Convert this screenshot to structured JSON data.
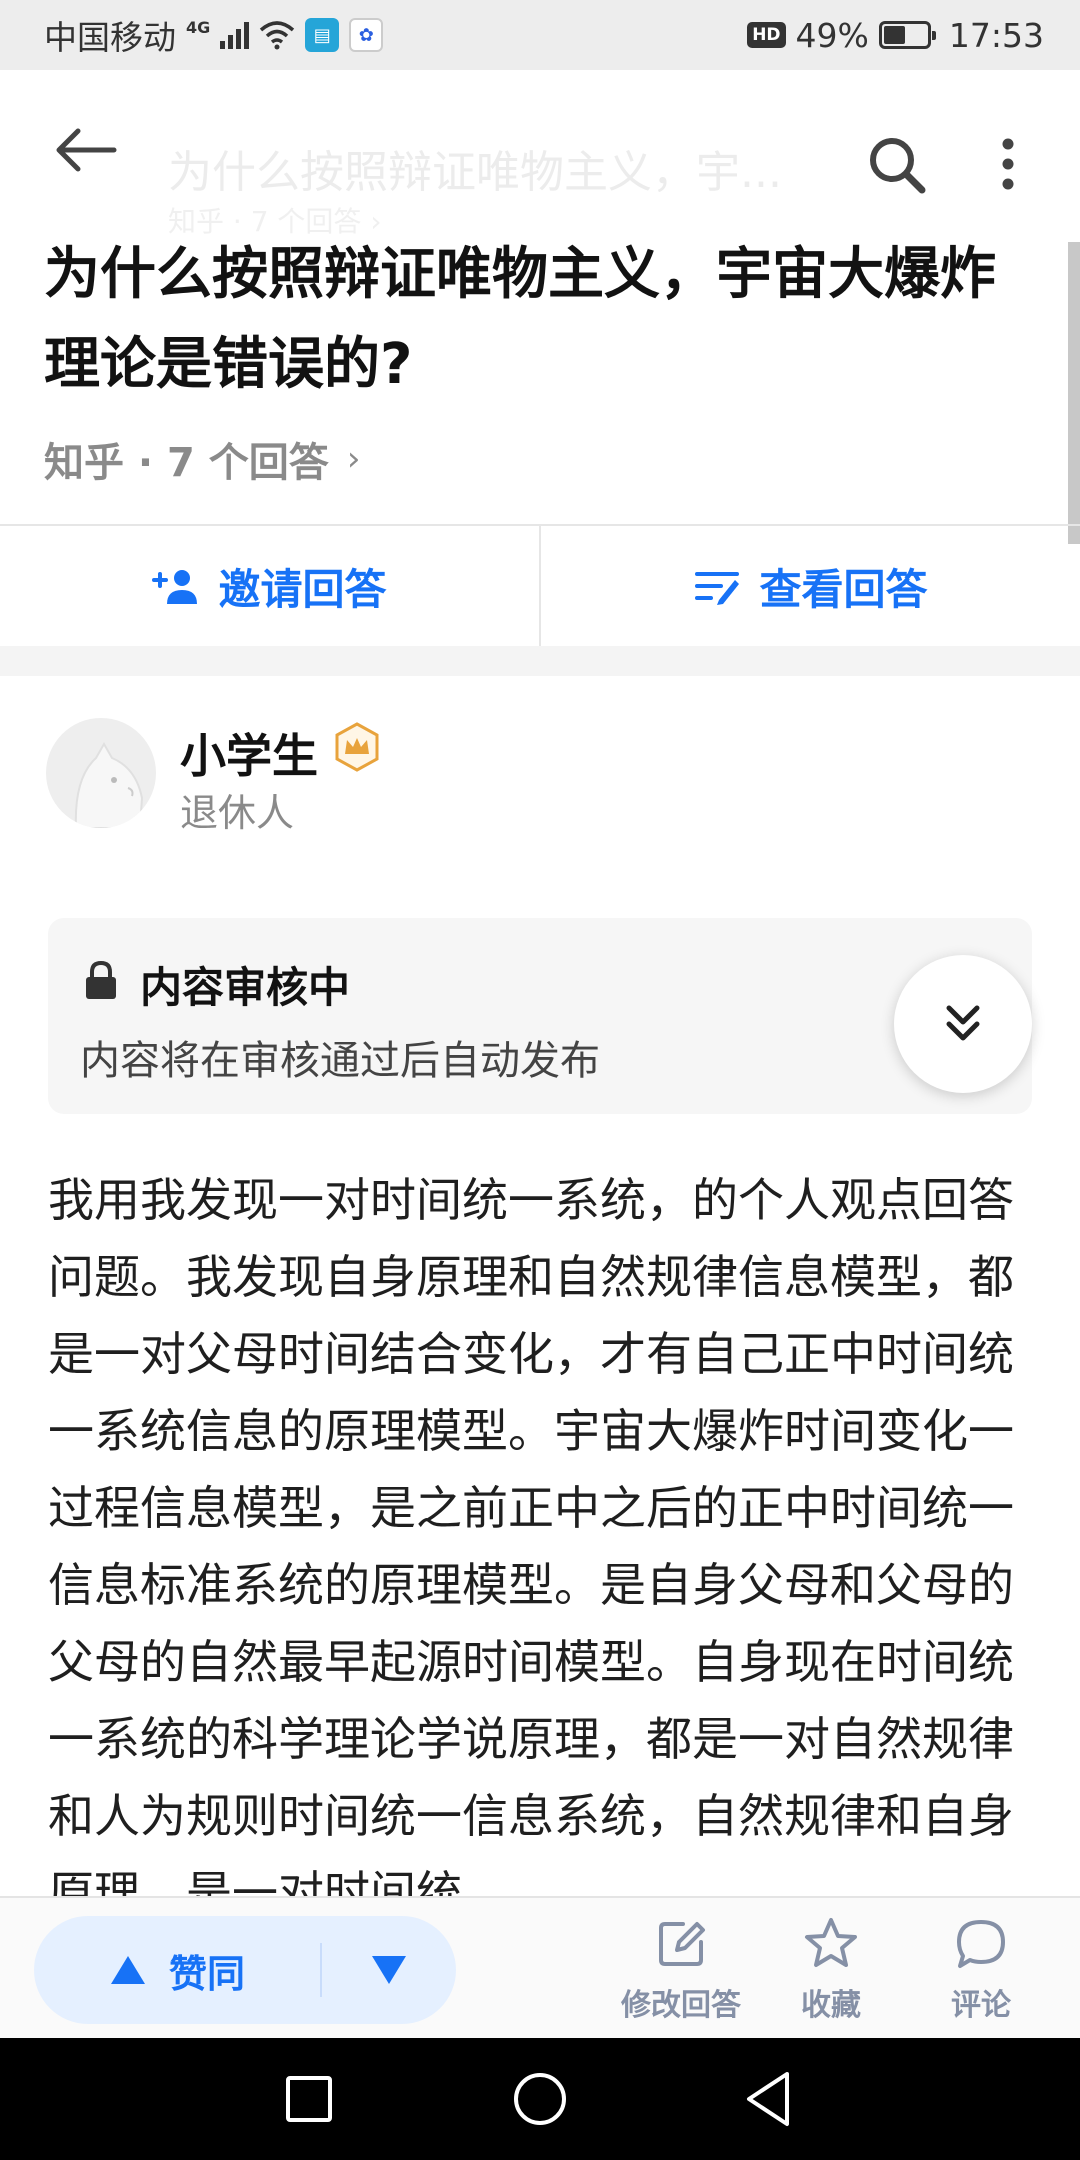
{
  "status_bar": {
    "carrier": "中国移动",
    "network": "4G",
    "hd": "HD",
    "battery": "49%",
    "battery_level": 0.49,
    "time": "17:53"
  },
  "top_bar": {
    "ghost_title": "为什么按照辩证唯物主义，宇...",
    "ghost_sub": "知乎 · 7 个回答 ›"
  },
  "question": {
    "title": "为什么按照辩证唯物主义，宇宙大爆炸理论是错误的?",
    "source": "知乎 · 7 个回答",
    "chevron": "›"
  },
  "actions": {
    "invite": "邀请回答",
    "view": "查看回答"
  },
  "author": {
    "name": "小学生",
    "desc": "退休人"
  },
  "review": {
    "title": "内容审核中",
    "desc": "内容将在审核通过后自动发布"
  },
  "answer": {
    "text": "我用我发现一对时间统一系统，的个人观点回答问题。我发现自身原理和自然规律信息模型，都是一对父母时间结合变化，才有自己正中时间统一系统信息的原理模型。宇宙大爆炸时间变化一过程信息模型，是之前正中之后的正中时间统一信息标准系统的原理模型。是自身父母和父母的父母的自然最早起源时间模型。自身现在时间统一系统的科学理论学说原理，都是一对自然规律和人为规则时间统一信息系统，自然规律和自身原理，是一对时间统"
  },
  "bottom_bar": {
    "upvote": "赞同",
    "edit": "修改回答",
    "favorite": "收藏",
    "comment": "评论"
  },
  "colors": {
    "accent": "#1772f6",
    "muted": "#8590a6",
    "badge": "#e8a33c"
  },
  "icons": [
    "back-arrow-icon",
    "search-icon",
    "more-vertical-icon",
    "invite-person-icon",
    "view-answers-icon",
    "crown-badge-icon",
    "lock-icon",
    "double-chevron-down-icon",
    "upvote-triangle-icon",
    "downvote-triangle-icon",
    "edit-icon",
    "star-icon",
    "comment-icon"
  ]
}
